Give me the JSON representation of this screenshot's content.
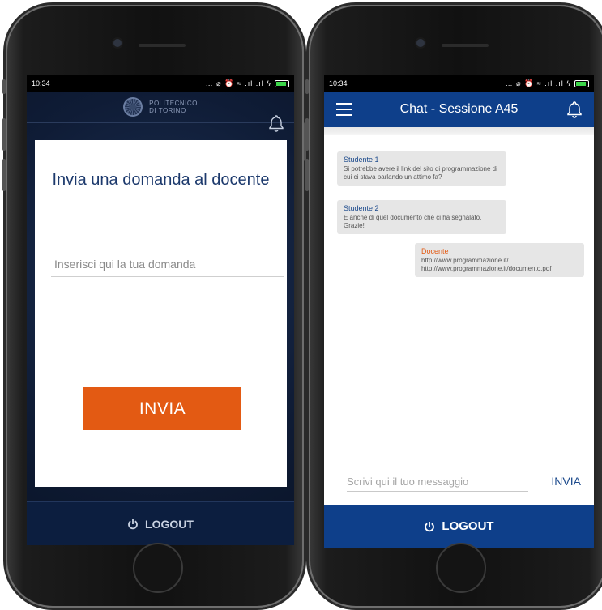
{
  "left_screen": {
    "status_time": "10:34",
    "status_icons": "… ⌀ ⏰ ≈ .ıl .ıl ϟ",
    "logo_line1": "POLITECNICO",
    "logo_line2": "DI TORINO",
    "card_title": "Invia una domanda al docente",
    "question_placeholder": "Inserisci qui la tua domanda",
    "send_label": "INVIA",
    "logout_label": "LOGOUT",
    "colors": {
      "header_bg": "#0f1c36",
      "button": "#e35a13",
      "title": "#1d3a6d"
    }
  },
  "right_screen": {
    "status_time": "10:34",
    "status_icons": "… ⌀ ⏰ ≈ .ıl .ıl ϟ",
    "title": "Chat - Sessione A45",
    "messages": [
      {
        "author": "Studente 1",
        "text": "Si potrebbe avere il link del sito di programmazione di cui ci stava parlando un attimo fa?"
      },
      {
        "author": "Studente 2",
        "text": "E anche di quel documento che ci ha segnalato. Grazie!"
      },
      {
        "author": "Docente",
        "text": "http://www.programmazione.it/ http://www.programmazione.it/documento.pdf"
      }
    ],
    "compose_placeholder": "Scrivi qui il tuo messaggio",
    "send_label": "INVIA",
    "logout_label": "LOGOUT",
    "colors": {
      "appbar": "#0e3f8a",
      "teacher_author": "#e35a13",
      "student_author": "#1c4a8c"
    }
  }
}
